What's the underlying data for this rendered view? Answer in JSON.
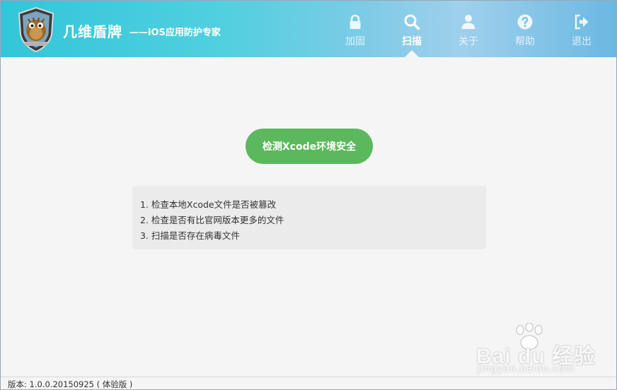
{
  "app": {
    "title": "几维盾牌",
    "subtitle": "——iOS应用防护专家"
  },
  "nav": {
    "items": [
      {
        "label": "加固",
        "icon": "lock-icon"
      },
      {
        "label": "扫描",
        "icon": "search-icon",
        "active": true
      },
      {
        "label": "关于",
        "icon": "user-icon"
      },
      {
        "label": "帮助",
        "icon": "help-icon"
      },
      {
        "label": "退出",
        "icon": "logout-icon"
      }
    ]
  },
  "main": {
    "scan_button_label": "检测Xcode环境安全",
    "info_lines": [
      "1. 检查本地Xcode文件是否被篡改",
      "2. 检查是否有比官网版本更多的文件",
      "3. 扫描是否存在病毒文件"
    ]
  },
  "footer": {
    "version": "版本: 1.0.0.20150925 ( 体验版 )"
  },
  "watermark": {
    "brand": "Bai du 经验",
    "url": "jingyan.baidu.com"
  },
  "colors": {
    "header_start": "#33c5d9",
    "header_end": "#6ab8e2",
    "primary_button": "#5cb85c",
    "info_box": "#ebebeb"
  }
}
